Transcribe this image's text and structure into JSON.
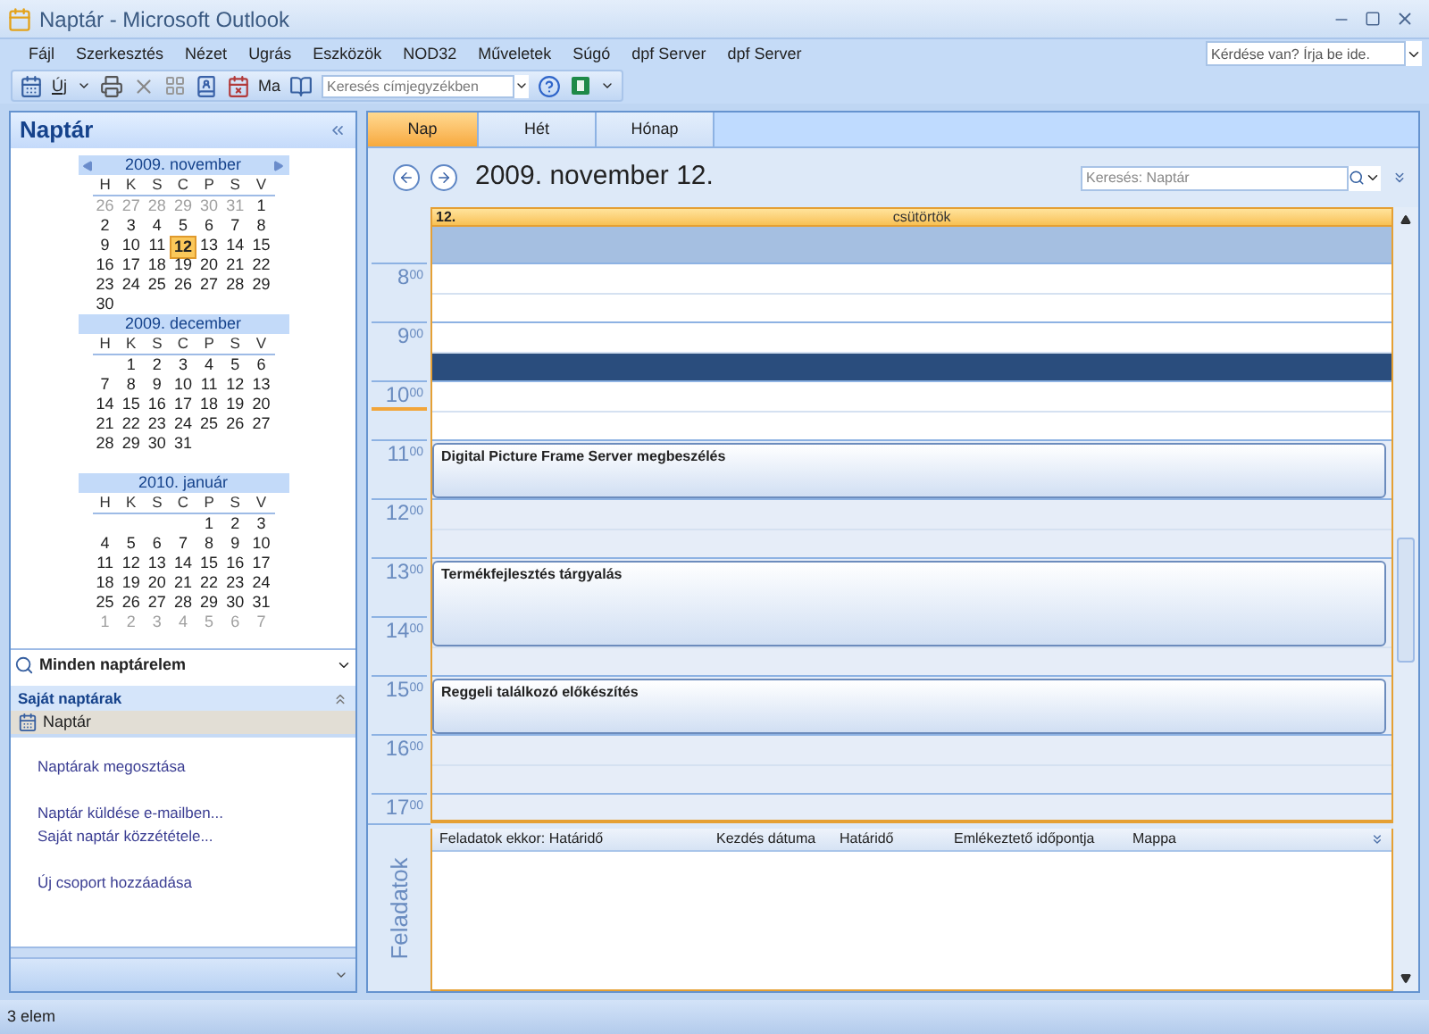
{
  "window": {
    "title": "Naptár - Microsoft Outlook"
  },
  "menu": [
    "Fájl",
    "Szerkesztés",
    "Nézet",
    "Ugrás",
    "Eszközök",
    "NOD32",
    "Műveletek",
    "Súgó",
    "dpf Server",
    "dpf Server"
  ],
  "help_box": {
    "placeholder": "Kérdése van? Írja be ide."
  },
  "toolbar": {
    "new_button": "Új",
    "today_button": "Ma",
    "address_search": {
      "placeholder": "Keresés címjegyzékben"
    }
  },
  "navigation": {
    "title": "Naptár",
    "months": [
      {
        "title": "2009. november",
        "arrows": true,
        "weekdays": [
          "H",
          "K",
          "S",
          "C",
          "P",
          "S",
          "V"
        ],
        "weeks": [
          [
            {
              "day": "26",
              "other_month": true,
              "selected": false
            },
            {
              "day": "27",
              "other_month": true,
              "selected": false
            },
            {
              "day": "28",
              "other_month": true,
              "selected": false
            },
            {
              "day": "29",
              "other_month": true,
              "selected": false
            },
            {
              "day": "30",
              "other_month": true,
              "selected": false
            },
            {
              "day": "31",
              "other_month": true,
              "selected": false
            },
            {
              "day": "1",
              "other_month": false,
              "selected": false
            }
          ],
          [
            {
              "day": "2",
              "other_month": false,
              "selected": false
            },
            {
              "day": "3",
              "other_month": false,
              "selected": false
            },
            {
              "day": "4",
              "other_month": false,
              "selected": false
            },
            {
              "day": "5",
              "other_month": false,
              "selected": false
            },
            {
              "day": "6",
              "other_month": false,
              "selected": false
            },
            {
              "day": "7",
              "other_month": false,
              "selected": false
            },
            {
              "day": "8",
              "other_month": false,
              "selected": false
            }
          ],
          [
            {
              "day": "9",
              "other_month": false,
              "selected": false
            },
            {
              "day": "10",
              "other_month": false,
              "selected": false
            },
            {
              "day": "11",
              "other_month": false,
              "selected": false
            },
            {
              "day": "12",
              "other_month": false,
              "selected": true
            },
            {
              "day": "13",
              "other_month": false,
              "selected": false
            },
            {
              "day": "14",
              "other_month": false,
              "selected": false
            },
            {
              "day": "15",
              "other_month": false,
              "selected": false
            }
          ],
          [
            {
              "day": "16",
              "other_month": false,
              "selected": false
            },
            {
              "day": "17",
              "other_month": false,
              "selected": false
            },
            {
              "day": "18",
              "other_month": false,
              "selected": false
            },
            {
              "day": "19",
              "other_month": false,
              "selected": false
            },
            {
              "day": "20",
              "other_month": false,
              "selected": false
            },
            {
              "day": "21",
              "other_month": false,
              "selected": false
            },
            {
              "day": "22",
              "other_month": false,
              "selected": false
            }
          ],
          [
            {
              "day": "23",
              "other_month": false,
              "selected": false
            },
            {
              "day": "24",
              "other_month": false,
              "selected": false
            },
            {
              "day": "25",
              "other_month": false,
              "selected": false
            },
            {
              "day": "26",
              "other_month": false,
              "selected": false
            },
            {
              "day": "27",
              "other_month": false,
              "selected": false
            },
            {
              "day": "28",
              "other_month": false,
              "selected": false
            },
            {
              "day": "29",
              "other_month": false,
              "selected": false
            }
          ],
          [
            {
              "day": "30",
              "other_month": false,
              "selected": false
            }
          ]
        ]
      },
      {
        "title": "2009. december",
        "arrows": false,
        "weekdays": [
          "H",
          "K",
          "S",
          "C",
          "P",
          "S",
          "V"
        ],
        "weeks": [
          [
            {
              "day": "1",
              "other_month": false,
              "selected": false
            },
            {
              "day": "2",
              "other_month": false,
              "selected": false
            },
            {
              "day": "3",
              "other_month": false,
              "selected": false
            },
            {
              "day": "4",
              "other_month": false,
              "selected": false
            },
            {
              "day": "5",
              "other_month": false,
              "selected": false
            },
            {
              "day": "6",
              "other_month": false,
              "selected": false
            }
          ],
          [
            {
              "day": "7",
              "other_month": false,
              "selected": false
            },
            {
              "day": "8",
              "other_month": false,
              "selected": false
            },
            {
              "day": "9",
              "other_month": false,
              "selected": false
            },
            {
              "day": "10",
              "other_month": false,
              "selected": false
            },
            {
              "day": "11",
              "other_month": false,
              "selected": false
            },
            {
              "day": "12",
              "other_month": false,
              "selected": false
            },
            {
              "day": "13",
              "other_month": false,
              "selected": false
            }
          ],
          [
            {
              "day": "14",
              "other_month": false,
              "selected": false
            },
            {
              "day": "15",
              "other_month": false,
              "selected": false
            },
            {
              "day": "16",
              "other_month": false,
              "selected": false
            },
            {
              "day": "17",
              "other_month": false,
              "selected": false
            },
            {
              "day": "18",
              "other_month": false,
              "selected": false
            },
            {
              "day": "19",
              "other_month": false,
              "selected": false
            },
            {
              "day": "20",
              "other_month": false,
              "selected": false
            }
          ],
          [
            {
              "day": "21",
              "other_month": false,
              "selected": false
            },
            {
              "day": "22",
              "other_month": false,
              "selected": false
            },
            {
              "day": "23",
              "other_month": false,
              "selected": false
            },
            {
              "day": "24",
              "other_month": false,
              "selected": false
            },
            {
              "day": "25",
              "other_month": false,
              "selected": false
            },
            {
              "day": "26",
              "other_month": false,
              "selected": false
            },
            {
              "day": "27",
              "other_month": false,
              "selected": false
            }
          ],
          [
            {
              "day": "28",
              "other_month": false,
              "selected": false
            },
            {
              "day": "29",
              "other_month": false,
              "selected": false
            },
            {
              "day": "30",
              "other_month": false,
              "selected": false
            },
            {
              "day": "31",
              "other_month": false,
              "selected": false
            }
          ]
        ]
      },
      {
        "title": "2010. január",
        "arrows": false,
        "weekdays": [
          "H",
          "K",
          "S",
          "C",
          "P",
          "S",
          "V"
        ],
        "weeks": [
          [
            {
              "day": "1",
              "other_month": false,
              "selected": false
            },
            {
              "day": "2",
              "other_month": false,
              "selected": false
            },
            {
              "day": "3",
              "other_month": false,
              "selected": false
            }
          ],
          [
            {
              "day": "4",
              "other_month": false,
              "selected": false
            },
            {
              "day": "5",
              "other_month": false,
              "selected": false
            },
            {
              "day": "6",
              "other_month": false,
              "selected": false
            },
            {
              "day": "7",
              "other_month": false,
              "selected": false
            },
            {
              "day": "8",
              "other_month": false,
              "selected": false
            },
            {
              "day": "9",
              "other_month": false,
              "selected": false
            },
            {
              "day": "10",
              "other_month": false,
              "selected": false
            }
          ],
          [
            {
              "day": "11",
              "other_month": false,
              "selected": false
            },
            {
              "day": "12",
              "other_month": false,
              "selected": false
            },
            {
              "day": "13",
              "other_month": false,
              "selected": false
            },
            {
              "day": "14",
              "other_month": false,
              "selected": false
            },
            {
              "day": "15",
              "other_month": false,
              "selected": false
            },
            {
              "day": "16",
              "other_month": false,
              "selected": false
            },
            {
              "day": "17",
              "other_month": false,
              "selected": false
            }
          ],
          [
            {
              "day": "18",
              "other_month": false,
              "selected": false
            },
            {
              "day": "19",
              "other_month": false,
              "selected": false
            },
            {
              "day": "20",
              "other_month": false,
              "selected": false
            },
            {
              "day": "21",
              "other_month": false,
              "selected": false
            },
            {
              "day": "22",
              "other_month": false,
              "selected": false
            },
            {
              "day": "23",
              "other_month": false,
              "selected": false
            },
            {
              "day": "24",
              "other_month": false,
              "selected": false
            }
          ],
          [
            {
              "day": "25",
              "other_month": false,
              "selected": false
            },
            {
              "day": "26",
              "other_month": false,
              "selected": false
            },
            {
              "day": "27",
              "other_month": false,
              "selected": false
            },
            {
              "day": "28",
              "other_month": false,
              "selected": false
            },
            {
              "day": "29",
              "other_month": false,
              "selected": false
            },
            {
              "day": "30",
              "other_month": false,
              "selected": false
            },
            {
              "day": "31",
              "other_month": false,
              "selected": false
            }
          ],
          [
            {
              "day": "1",
              "other_month": true,
              "selected": false
            },
            {
              "day": "2",
              "other_month": true,
              "selected": false
            },
            {
              "day": "3",
              "other_month": true,
              "selected": false
            },
            {
              "day": "4",
              "other_month": true,
              "selected": false
            },
            {
              "day": "5",
              "other_month": true,
              "selected": false
            },
            {
              "day": "6",
              "other_month": true,
              "selected": false
            },
            {
              "day": "7",
              "other_month": true,
              "selected": false
            }
          ]
        ]
      }
    ],
    "view_selector": "Minden naptárelem",
    "group": {
      "title": "Saját naptárak",
      "expanded": true,
      "items": [
        {
          "label": "Naptár",
          "selected": true
        }
      ]
    },
    "link_groups": [
      [
        "Naptárak megosztása"
      ],
      [
        "Naptár küldése e-mailben...",
        "Saját naptár közzététele..."
      ],
      [
        "Új csoport hozzáadása"
      ]
    ]
  },
  "view_tabs": [
    {
      "label": "Nap",
      "selected": true
    },
    {
      "label": "Hét",
      "selected": false
    },
    {
      "label": "Hónap",
      "selected": false
    }
  ],
  "date_title": "2009. november 12.",
  "search": {
    "placeholder": "Keresés: Naptár"
  },
  "day_header": {
    "day": "12.",
    "weekday": "csütörtök"
  },
  "hours": [
    {
      "hour": "8",
      "minutes": "00",
      "working": true,
      "current": false,
      "slots": [
        {
          "kind": "free",
          "selected": false
        },
        {
          "kind": "free",
          "selected": false
        }
      ]
    },
    {
      "hour": "9",
      "minutes": "00",
      "working": true,
      "current": false,
      "slots": [
        {
          "kind": "free",
          "selected": false
        },
        {
          "kind": "free",
          "selected": true
        }
      ]
    },
    {
      "hour": "10",
      "minutes": "00",
      "working": true,
      "current": true,
      "slots": [
        {
          "kind": "free",
          "selected": false
        },
        {
          "kind": "free",
          "selected": false
        }
      ]
    },
    {
      "hour": "11",
      "minutes": "00",
      "working": false,
      "current": false,
      "slots": [
        {
          "kind": "appointment",
          "title": "Digital Picture Frame Server megbeszélés"
        },
        {
          "kind": "busy"
        }
      ]
    },
    {
      "hour": "12",
      "minutes": "00",
      "working": false,
      "current": false,
      "slots": [
        {
          "kind": "free",
          "selected": false
        },
        {
          "kind": "free",
          "selected": false
        }
      ]
    },
    {
      "hour": "13",
      "minutes": "00",
      "working": false,
      "current": false,
      "slots": [
        {
          "kind": "appointment",
          "title": "Termékfejlesztés tárgyalás"
        },
        {
          "kind": "busy"
        }
      ]
    },
    {
      "hour": "14",
      "minutes": "00",
      "working": false,
      "current": false,
      "slots": [
        {
          "kind": "busy"
        },
        {
          "kind": "free",
          "selected": false
        }
      ]
    },
    {
      "hour": "15",
      "minutes": "00",
      "working": false,
      "current": false,
      "slots": [
        {
          "kind": "appointment",
          "title": "Reggeli találkozó előkészítés"
        },
        {
          "kind": "busy"
        }
      ]
    },
    {
      "hour": "16",
      "minutes": "00",
      "working": false,
      "current": false,
      "slots": [
        {
          "kind": "free",
          "selected": false
        },
        {
          "kind": "free",
          "selected": false
        }
      ]
    },
    {
      "hour": "17",
      "minutes": "00",
      "working": false,
      "current": false,
      "slots": [
        {
          "kind": "free",
          "selected": false
        }
      ]
    }
  ],
  "tasks": {
    "label": "Feladatok",
    "columns": [
      "Feladatok ekkor: Határidő",
      "Kezdés dátuma",
      "Határidő",
      "Emlékeztető időpontja",
      "Mappa"
    ]
  },
  "status_bar": "3 elem"
}
